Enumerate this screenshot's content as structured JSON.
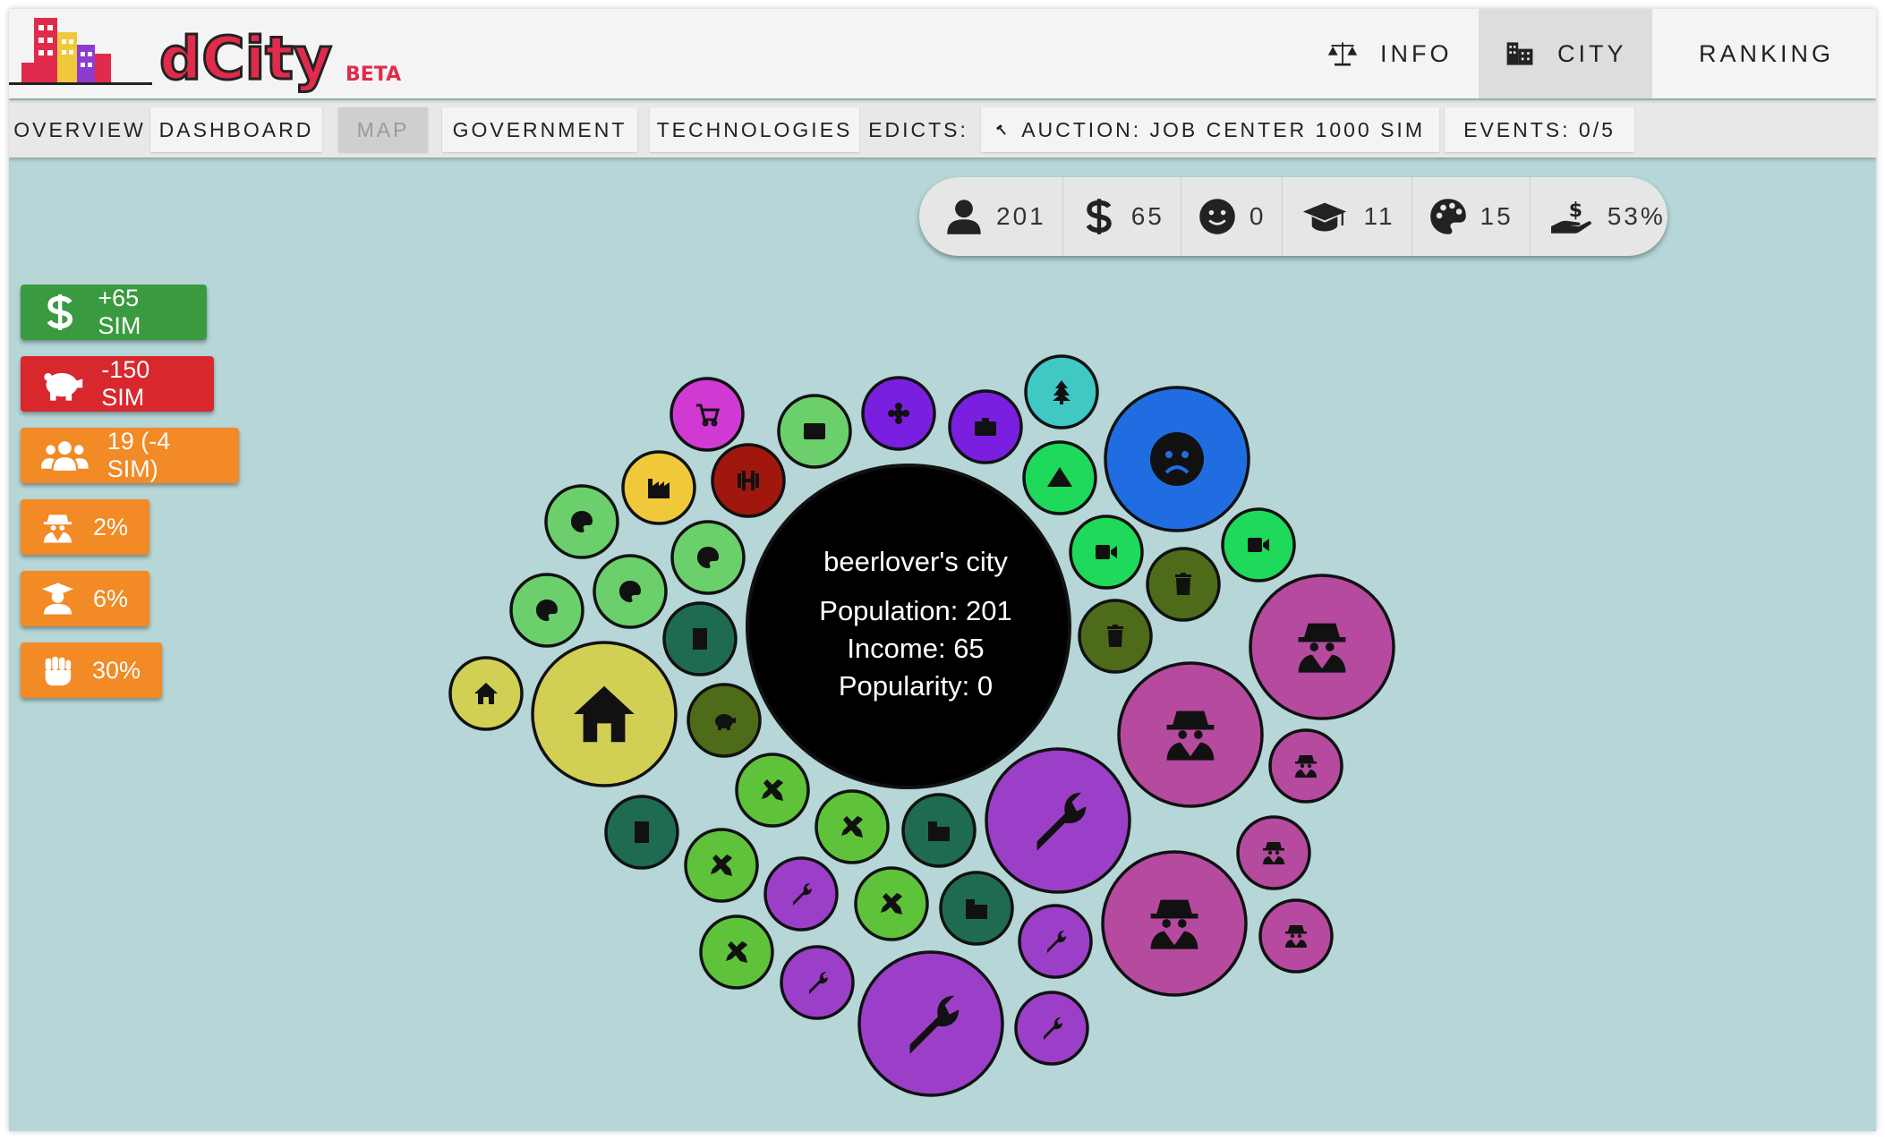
{
  "app": {
    "logo_text": "dCity",
    "logo_badge": "BETA"
  },
  "nav": [
    {
      "label": "INFO",
      "icon": "balance-scale-icon",
      "active": false
    },
    {
      "label": "CITY",
      "icon": "city-icon",
      "active": true
    },
    {
      "label": "RANKING",
      "icon": "trophy-icon",
      "active": false
    }
  ],
  "subnav": {
    "overview": "OVERVIEW",
    "dashboard": "DASHBOARD",
    "map": "MAP",
    "government": "GOVERNMENT",
    "technologies": "TECHNOLOGIES",
    "edicts_label": "EDICTS:",
    "edict": "AUCTION: JOB CENTER 1000 SIM",
    "events": "EVENTS: 0/5"
  },
  "stats": {
    "population": "201",
    "income": "65",
    "popularity": "0",
    "education": "11",
    "culture": "15",
    "tax": "53%"
  },
  "badges": [
    {
      "text": "+65 SIM",
      "icon": "dollar-icon",
      "color": "#3a9a3f"
    },
    {
      "text": "-150 SIM",
      "icon": "piggy-bank-icon",
      "color": "#d8282e"
    },
    {
      "text": "19 (-4 SIM)",
      "icon": "users-icon",
      "color": "#f28a25"
    },
    {
      "text": "2%",
      "icon": "spy-icon",
      "color": "#f28a25"
    },
    {
      "text": "6%",
      "icon": "graduate-icon",
      "color": "#f28a25"
    },
    {
      "text": "30%",
      "icon": "fist-icon",
      "color": "#f28a25"
    }
  ],
  "city": {
    "name": "beerlover's city",
    "population": "Population: 201",
    "income": "Income: 65",
    "popularity": "Popularity: 0"
  },
  "colors": {
    "purple": "#9b3fc9",
    "magenta": "#b54a9f",
    "lime": "#5ec33a",
    "teal": "#1f6b52",
    "blue": "#1f6de0",
    "yellow": "#d2cf55",
    "light_green": "#6bcf6b",
    "olive": "#4e6b1a",
    "bright_green": "#1ed95a",
    "cyan": "#3fc8c4",
    "violet": "#7a1fe0",
    "pink": "#d13ad2",
    "dark_red": "#a0170d",
    "gold": "#f0c93a"
  }
}
